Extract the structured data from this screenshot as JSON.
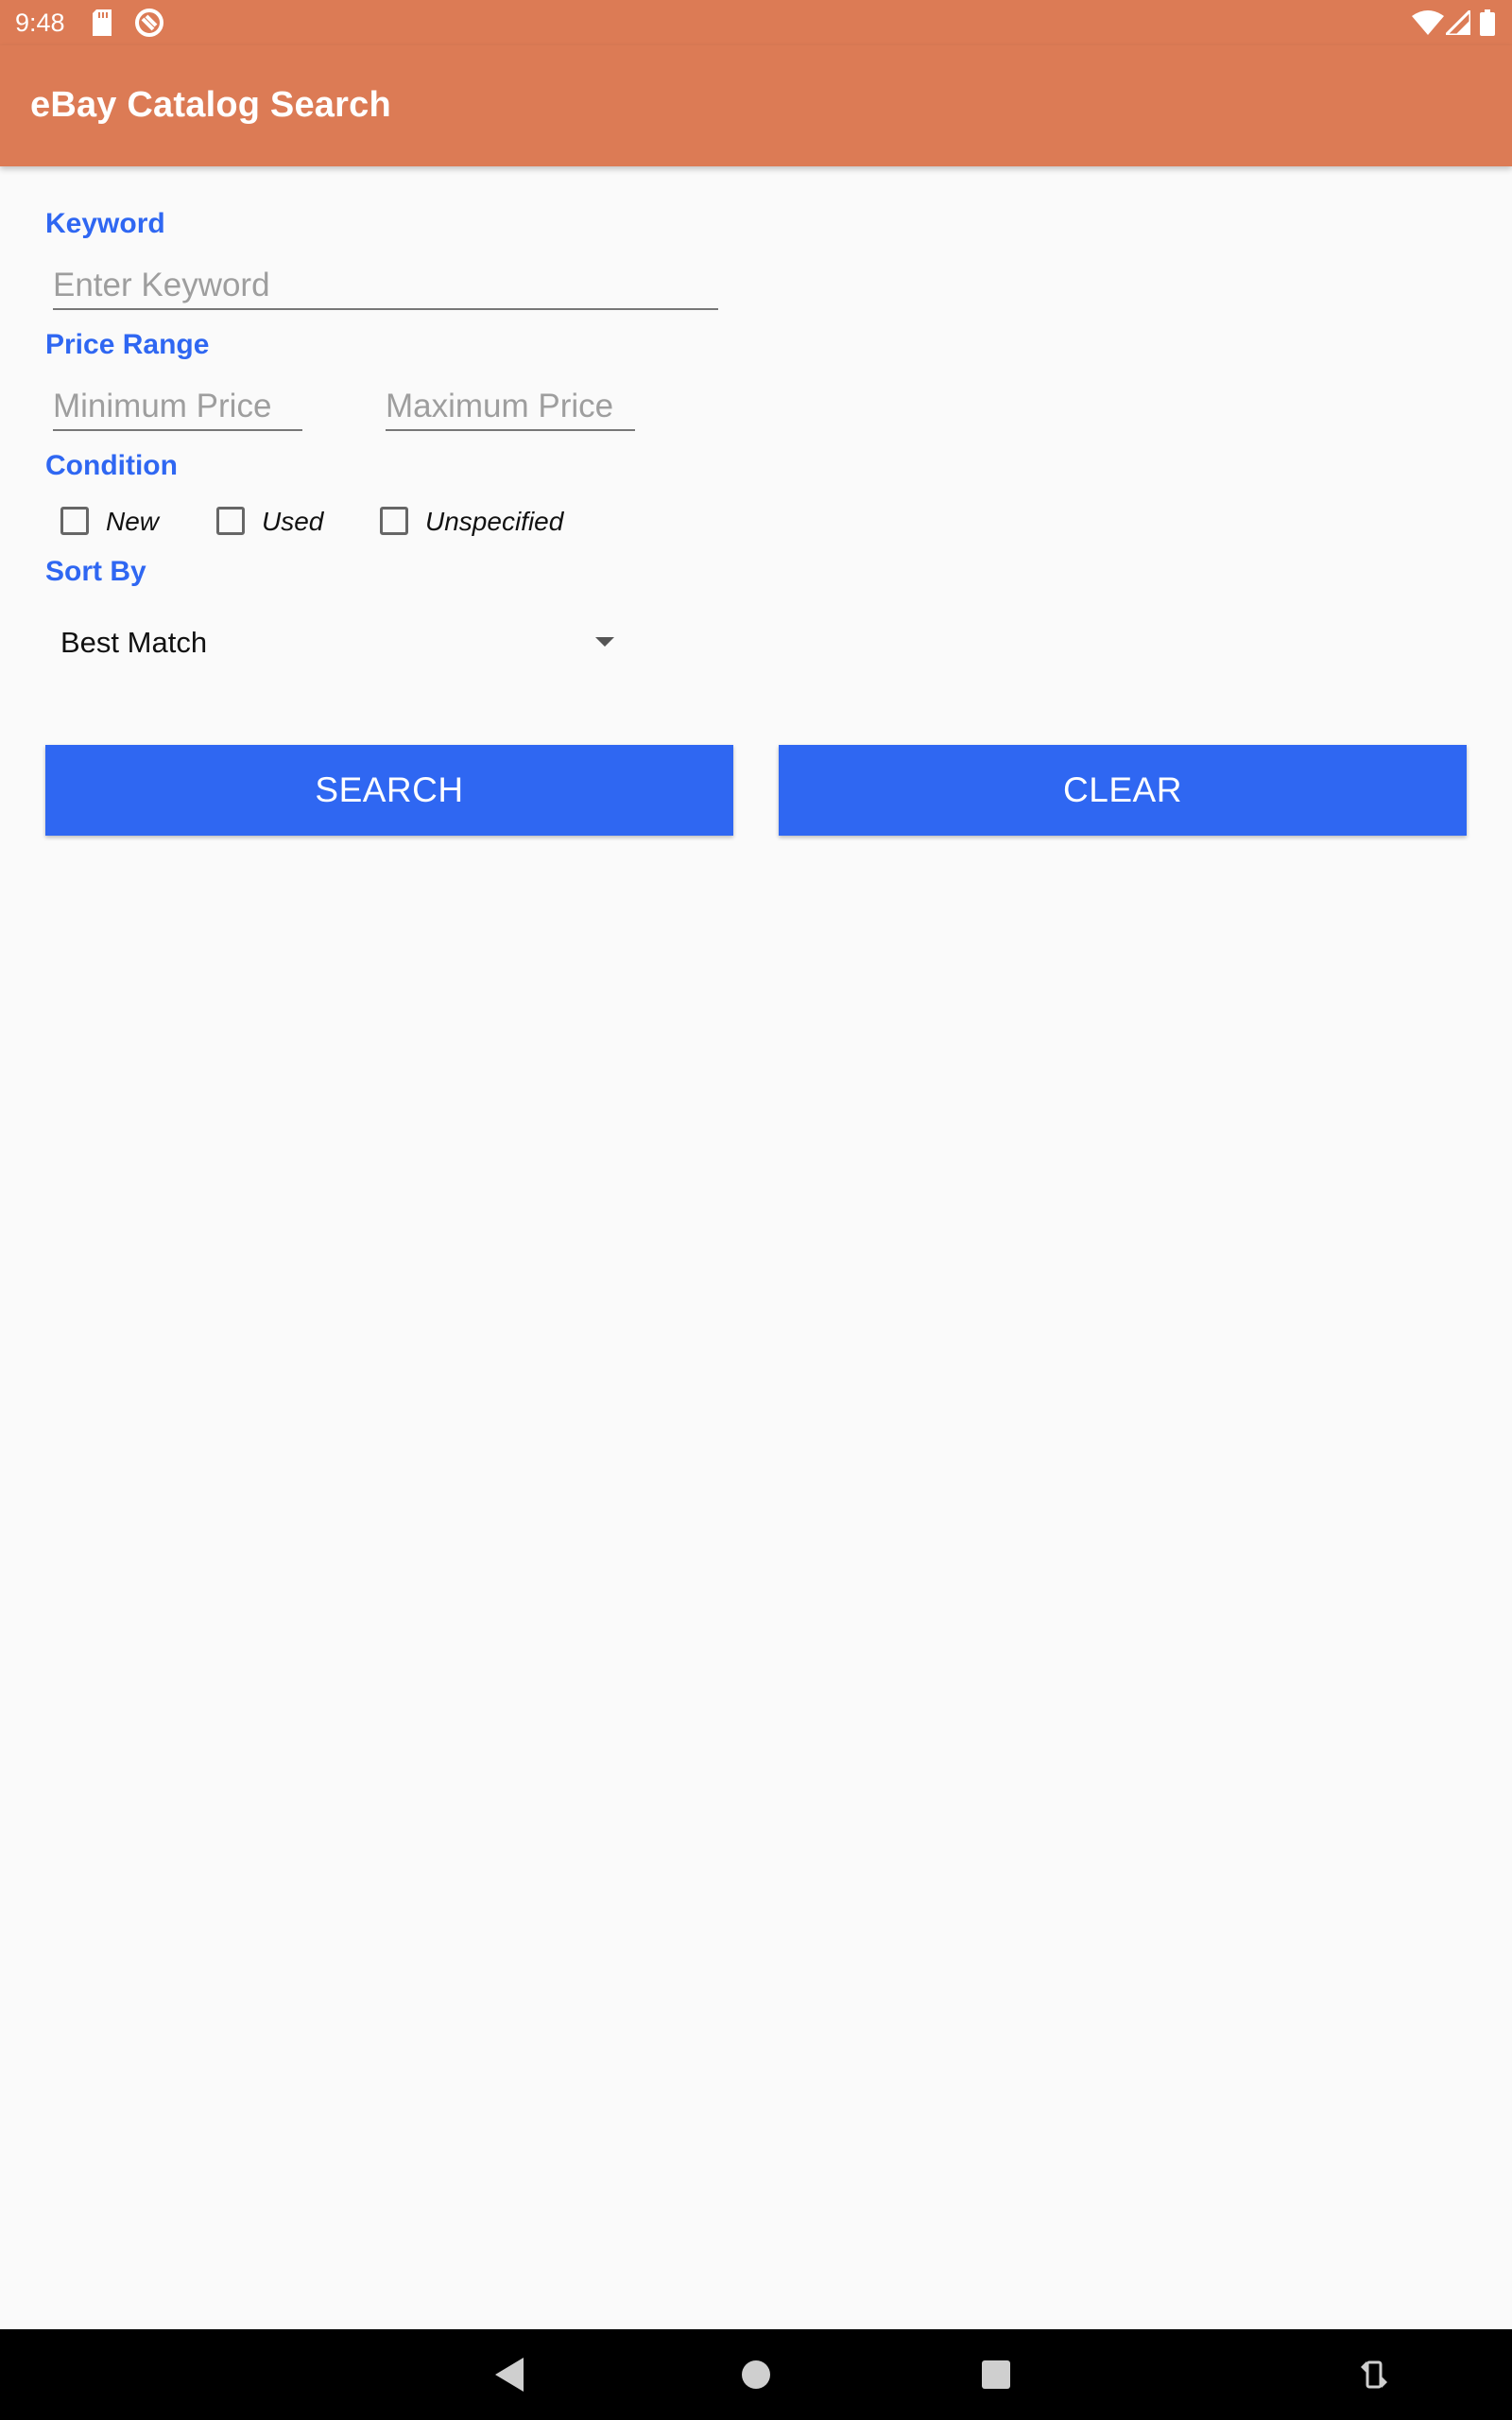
{
  "status_bar": {
    "time": "9:48",
    "left_icons": [
      "sd-card-icon",
      "sync-icon"
    ],
    "right_icons": [
      "wifi-icon",
      "cell-signal-icon",
      "battery-icon"
    ]
  },
  "app_bar": {
    "title": "eBay Catalog Search",
    "color": "#dc7b55"
  },
  "form": {
    "keyword": {
      "label": "Keyword",
      "value": "",
      "placeholder": "Enter Keyword"
    },
    "price_range": {
      "label": "Price Range",
      "min": {
        "value": "",
        "placeholder": "Minimum Price"
      },
      "max": {
        "value": "",
        "placeholder": "Maximum Price"
      }
    },
    "condition": {
      "label": "Condition",
      "options": [
        {
          "label": "New",
          "checked": false
        },
        {
          "label": "Used",
          "checked": false
        },
        {
          "label": "Unspecified",
          "checked": false
        }
      ]
    },
    "sort_by": {
      "label": "Sort By",
      "selected": "Best Match"
    }
  },
  "buttons": {
    "search": "SEARCH",
    "clear": "CLEAR"
  },
  "colors": {
    "accent": "#2f67f2",
    "background": "#fafafa"
  },
  "nav_bar": {
    "icons": [
      "back-icon",
      "home-icon",
      "recents-icon",
      "rotate-icon"
    ]
  }
}
